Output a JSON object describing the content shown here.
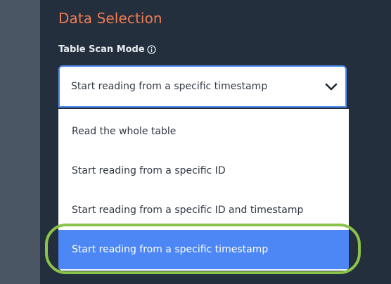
{
  "section": {
    "title": "Data Selection"
  },
  "field": {
    "label": "Table Scan Mode",
    "info_icon": "info-circle-icon",
    "selected_value": "Start reading from a specific timestamp",
    "dropdown_icon": "chevron-down-icon"
  },
  "dropdown": {
    "options": [
      {
        "label": "Read the whole table",
        "selected": false
      },
      {
        "label": "Start reading from a specific ID",
        "selected": false
      },
      {
        "label": "Start reading from a specific ID and timestamp",
        "selected": false
      },
      {
        "label": "Start reading from a specific timestamp",
        "selected": true
      }
    ]
  },
  "colors": {
    "title_accent": "#f07a52",
    "selected_option_bg": "#4d86f5",
    "focus_border": "#4f8df7",
    "highlight_ring": "#8bc34a",
    "panel_bg": "#242f3d"
  }
}
